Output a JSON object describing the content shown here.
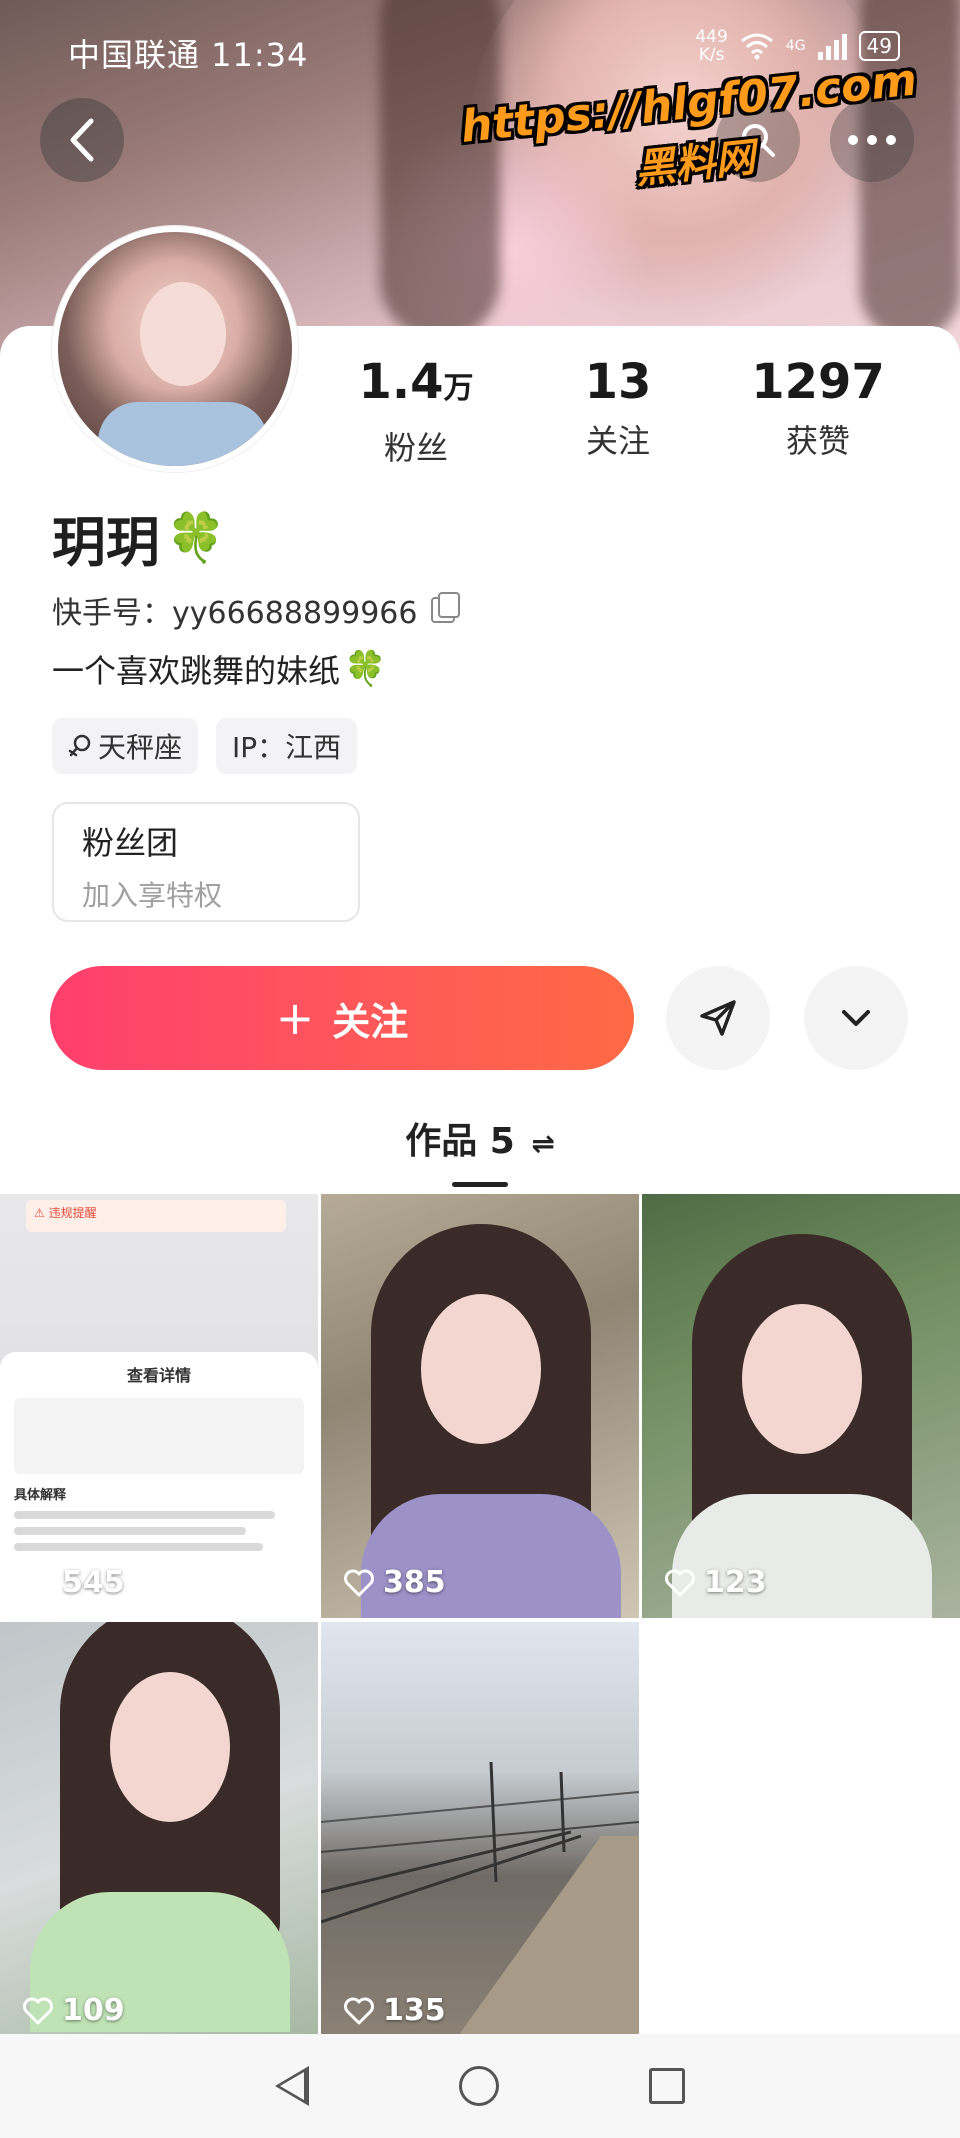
{
  "status_bar": {
    "carrier_time": "中国联通 11:34",
    "net_speed_value": "449",
    "net_speed_unit": "K/s",
    "network": "4G",
    "battery": "49"
  },
  "watermark": {
    "url": "https://hlgf07.com",
    "name": "黑料网"
  },
  "profile": {
    "name": "玥玥",
    "name_emoji": "🍀",
    "kuaishou_id": "快手号：yy66688899966",
    "bio": "一个喜欢跳舞的妹纸",
    "bio_emoji": "🍀",
    "tags": [
      {
        "icon": "zodiac-icon",
        "label": "天秤座"
      },
      {
        "label": "IP：江西"
      }
    ]
  },
  "stats": {
    "fans": {
      "value": "1.4",
      "unit": "万",
      "label": "粉丝"
    },
    "following": {
      "value": "13",
      "label": "关注"
    },
    "likes": {
      "value": "1297",
      "label": "获赞"
    }
  },
  "fan_club": {
    "title": "粉丝团",
    "subtitle": "加入享特权"
  },
  "actions": {
    "follow_label": "关注",
    "follow_plus": "+"
  },
  "works": {
    "label": "作品 5",
    "sort_symbol": "⇌"
  },
  "tile1": {
    "alert": "违规提醒",
    "detail_title": "查看详情",
    "detail_section": "具体解释"
  },
  "grid": [
    {
      "likes": "545"
    },
    {
      "likes": "385"
    },
    {
      "likes": "123"
    },
    {
      "likes": "109"
    },
    {
      "likes": "135"
    }
  ],
  "colors": {
    "follow_gradient_start": "#ff3f6e",
    "follow_gradient_end": "#ff6a44",
    "watermark": "#ff9a1a"
  }
}
